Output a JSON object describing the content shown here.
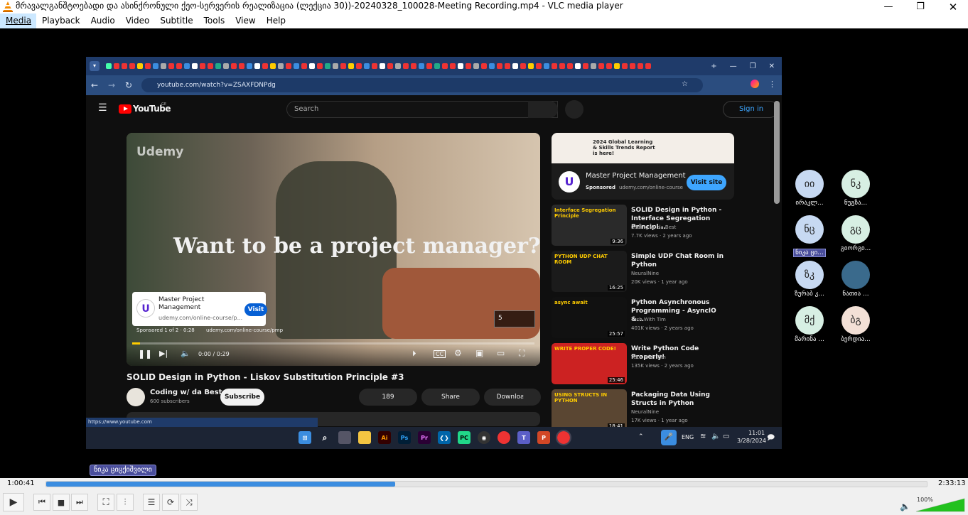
{
  "window": {
    "title": "მრავალგანშტოებადი და ასინქრონული ქეო-სერვერის რეალიზაცია (ლექცია 30))-20240328_100028-Meeting Recording.mp4 - VLC media player"
  },
  "menu": [
    "Media",
    "Playback",
    "Audio",
    "Video",
    "Subtitle",
    "Tools",
    "View",
    "Help"
  ],
  "browser": {
    "url": "youtube.com/watch?v=ZSAXFDNPdg",
    "status_url": "https://www.youtube.com"
  },
  "youtube": {
    "logo": "YouTube",
    "country": "GE",
    "search_placeholder": "Search",
    "signin": "Sign in",
    "ad_headline": "Want to be a project manager?",
    "ad_brand": "Udemy",
    "ad_card": {
      "title": "Master Project Management",
      "url": "udemy.com/online-course/p...",
      "visit": "Visit"
    },
    "ad_info": "Sponsored 1 of 2 · 0:28",
    "ad_info_url": "udemy.com/online-course/pmp",
    "skip_count": "5",
    "player_time": "0:00 / 0:29",
    "video_title": "SOLID Design in Python - Liskov Substitution Principle #3",
    "channel": "Coding w/ da Best",
    "subscribers": "600 subscribers",
    "subscribe": "Subscribe",
    "likes": "189",
    "share": "Share",
    "download": "Download",
    "sidebar_ad": {
      "banner": "2024 Global Learning & Skills Trends Report is here!",
      "title": "Master Project Management",
      "sponsored": "Sponsored",
      "url": "udemy.com/online-course",
      "visit": "Visit site"
    },
    "recommendations": [
      {
        "title": "SOLID Design in Python - Interface Segregation Principl...",
        "channel": "Coding w/ da Best",
        "meta": "7.7K views · 2 years ago",
        "duration": "9:36",
        "thumb_text": "Interface Segregation Principle"
      },
      {
        "title": "Simple UDP Chat Room in Python",
        "channel": "NeuralNine",
        "meta": "20K views · 1 year ago",
        "duration": "16:25",
        "thumb_text": "PYTHON UDP CHAT ROOM"
      },
      {
        "title": "Python Asynchronous Programming - AsyncIO &...",
        "channel": "Tech With Tim",
        "meta": "401K views · 2 years ago",
        "duration": "25:57",
        "thumb_text": "async await"
      },
      {
        "title": "Write Python Code Properly!",
        "channel": "Tech With Tim",
        "meta": "135K views · 2 years ago",
        "duration": "25:46",
        "thumb_text": "WRITE PROPER CODE!"
      },
      {
        "title": "Packaging Data Using Structs in Python",
        "channel": "NeuralNine",
        "meta": "17K views · 1 year ago",
        "duration": "18:41",
        "thumb_text": "USING STRUCTS IN PYTHON"
      }
    ]
  },
  "taskbar": {
    "lang": "ENG",
    "time": "11:01",
    "date": "3/28/2024"
  },
  "participants": [
    {
      "initials": "იი",
      "name": "ირაკლ...",
      "color": "#c7d9f2"
    },
    {
      "initials": "ნკ",
      "name": "ნუგზა...",
      "color": "#d7efe3"
    },
    {
      "initials": "ნც",
      "name": "ნიკა ცი...",
      "color": "#c7d9f2",
      "highlight": true
    },
    {
      "initials": "გც",
      "name": "გიორგი...",
      "color": "#d7efe3"
    },
    {
      "initials": "ზკ",
      "name": "ზურაბ კ...",
      "color": "#c7d9f2"
    },
    {
      "initials": "",
      "name": "ნათია ...",
      "color": "#3a6a8c"
    },
    {
      "initials": "მქ",
      "name": "მარინა ...",
      "color": "#d7efe3"
    },
    {
      "initials": "ბგ",
      "name": "ბერდია...",
      "color": "#f3e0d6"
    }
  ],
  "speaker_label": "ნიკა ციცქიშვილი",
  "vlc": {
    "elapsed": "1:00:41",
    "total": "2:33:13",
    "progress": 0.396,
    "volume": "100%"
  }
}
